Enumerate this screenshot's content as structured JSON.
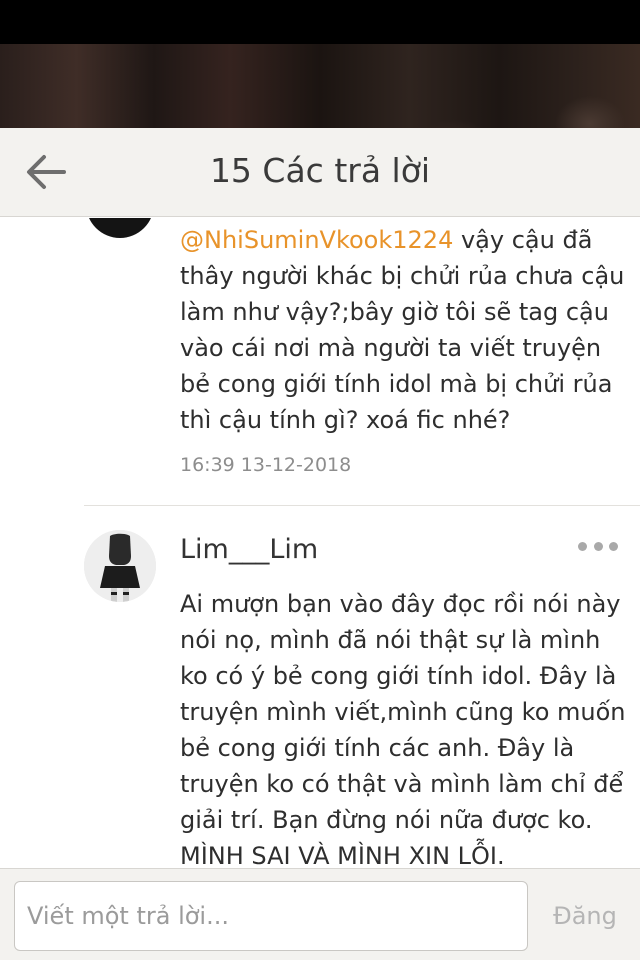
{
  "header": {
    "title": "15 Các trả lời",
    "back_icon": "arrow-left-icon"
  },
  "comments": [
    {
      "mention": "@NhiSuminVkook1224",
      "text": " vậy cậu đã thây người khác bị chửi rủa chưa cậu làm như vậy?;bây giờ tôi sẽ tag cậu vào cái nơi mà người ta viết truyện bẻ cong giới tính idol mà bị chửi rủa thì cậu tính gì? xoá fic nhé?",
      "time": "16:39 13-12-2018"
    },
    {
      "username": "Lim___Lim",
      "text": "Ai mượn bạn vào đây đọc rồi nói này nói nọ, mình đã nói thật sự là mình ko có ý bẻ cong giới tính idol. Đây là truyện mình viết,mình cũng ko muốn bẻ cong giới tính các anh. Đây là truyện ko có thật và mình làm chỉ để giải trí. Bạn đừng nói nữa được ko. MÌNH SAI VÀ MÌNH XIN LỖI."
    }
  ],
  "footer": {
    "reply_placeholder": "Viết một trả lời...",
    "post_label": "Đăng"
  },
  "colors": {
    "mention": "#e8932a",
    "header_bg": "#f3f2ef",
    "timestamp": "#8d8d8d"
  }
}
